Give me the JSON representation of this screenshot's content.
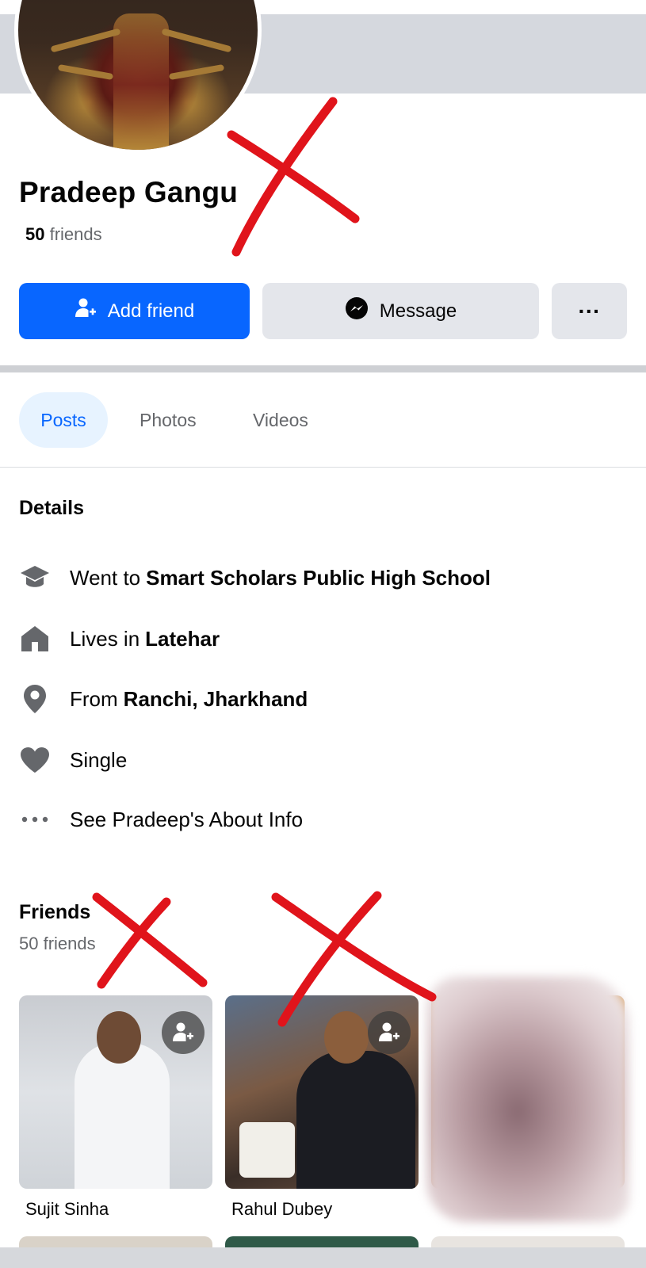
{
  "profile": {
    "name": "Pradeep Gangu",
    "friends_count": "50",
    "friends_word": "friends"
  },
  "actions": {
    "add_friend": "Add friend",
    "message": "Message",
    "more": "···"
  },
  "tabs": [
    {
      "label": "Posts",
      "active": true
    },
    {
      "label": "Photos",
      "active": false
    },
    {
      "label": "Videos",
      "active": false
    }
  ],
  "details": {
    "title": "Details",
    "items": [
      {
        "icon": "education-icon",
        "prefix": "Went to",
        "value": "Smart Scholars Public High School"
      },
      {
        "icon": "home-icon",
        "prefix": "Lives in",
        "value": "Latehar"
      },
      {
        "icon": "location-pin-icon",
        "prefix": "From",
        "value": "Ranchi, Jharkhand"
      },
      {
        "icon": "heart-icon",
        "prefix": "Single",
        "value": ""
      },
      {
        "icon": "more-dots-icon",
        "prefix": "See Pradeep's About Info",
        "value": ""
      }
    ]
  },
  "friends": {
    "title": "Friends",
    "subtitle": "50 friends",
    "cards": [
      {
        "name": "Sujit Sinha"
      },
      {
        "name": "Rahul Dubey"
      },
      {
        "name": ""
      }
    ]
  },
  "colors": {
    "primary": "#0866ff",
    "secondary_button": "#e4e6eb",
    "active_tab_bg": "#e7f3ff",
    "muted_text": "#65676b",
    "red_marks": "#e0141b"
  }
}
